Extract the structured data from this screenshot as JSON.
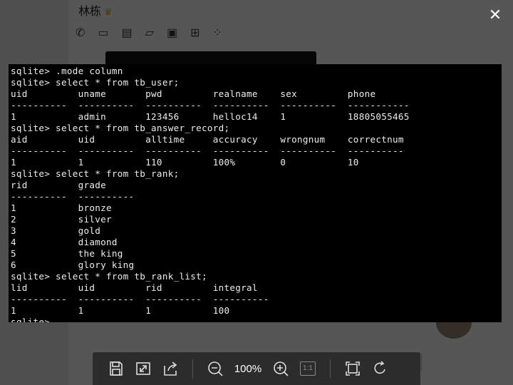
{
  "viewer": {
    "close_icon": "close-icon",
    "zoom_level": "100%",
    "actual_size_label": "1:1",
    "toolbar_icons": [
      "save-icon",
      "fit-window-icon",
      "share-icon",
      "zoom-out-icon",
      "zoom-in-icon",
      "actual-size-icon",
      "fullscreen-icon",
      "rotate-icon"
    ]
  },
  "background": {
    "contact_name": "林栋",
    "toolbar_icons": [
      "phone-icon",
      "video-icon",
      "screen-share-icon",
      "file-icon",
      "remote-desktop-icon",
      "add-chat-icon",
      "apps-icon"
    ]
  },
  "terminal": {
    "lines": [
      "sqlite> .mode column",
      "sqlite> select * from tb_user;",
      "uid         uname       pwd         realname    sex         phone",
      "----------  ----------  ----------  ----------  ----------  -----------",
      "1           admin       123456      helloc14    1           18805055465",
      "sqlite> select * from tb_answer_record;",
      "aid         uid         alltime     accuracy    wrongnum    correctnum",
      "----------  ----------  ----------  ----------  ----------  ----------",
      "1           1           110         100%        0           10",
      "sqlite> select * from tb_rank;",
      "rid         grade",
      "----------  ----------",
      "1           bronze",
      "2           silver",
      "3           gold",
      "4           diamond",
      "5           the king",
      "6           glory king",
      "sqlite> select * from tb_rank_list;",
      "lid         uid         rid         integral",
      "----------  ----------  ----------  ----------",
      "1           1           1           100",
      "sqlite>"
    ]
  }
}
